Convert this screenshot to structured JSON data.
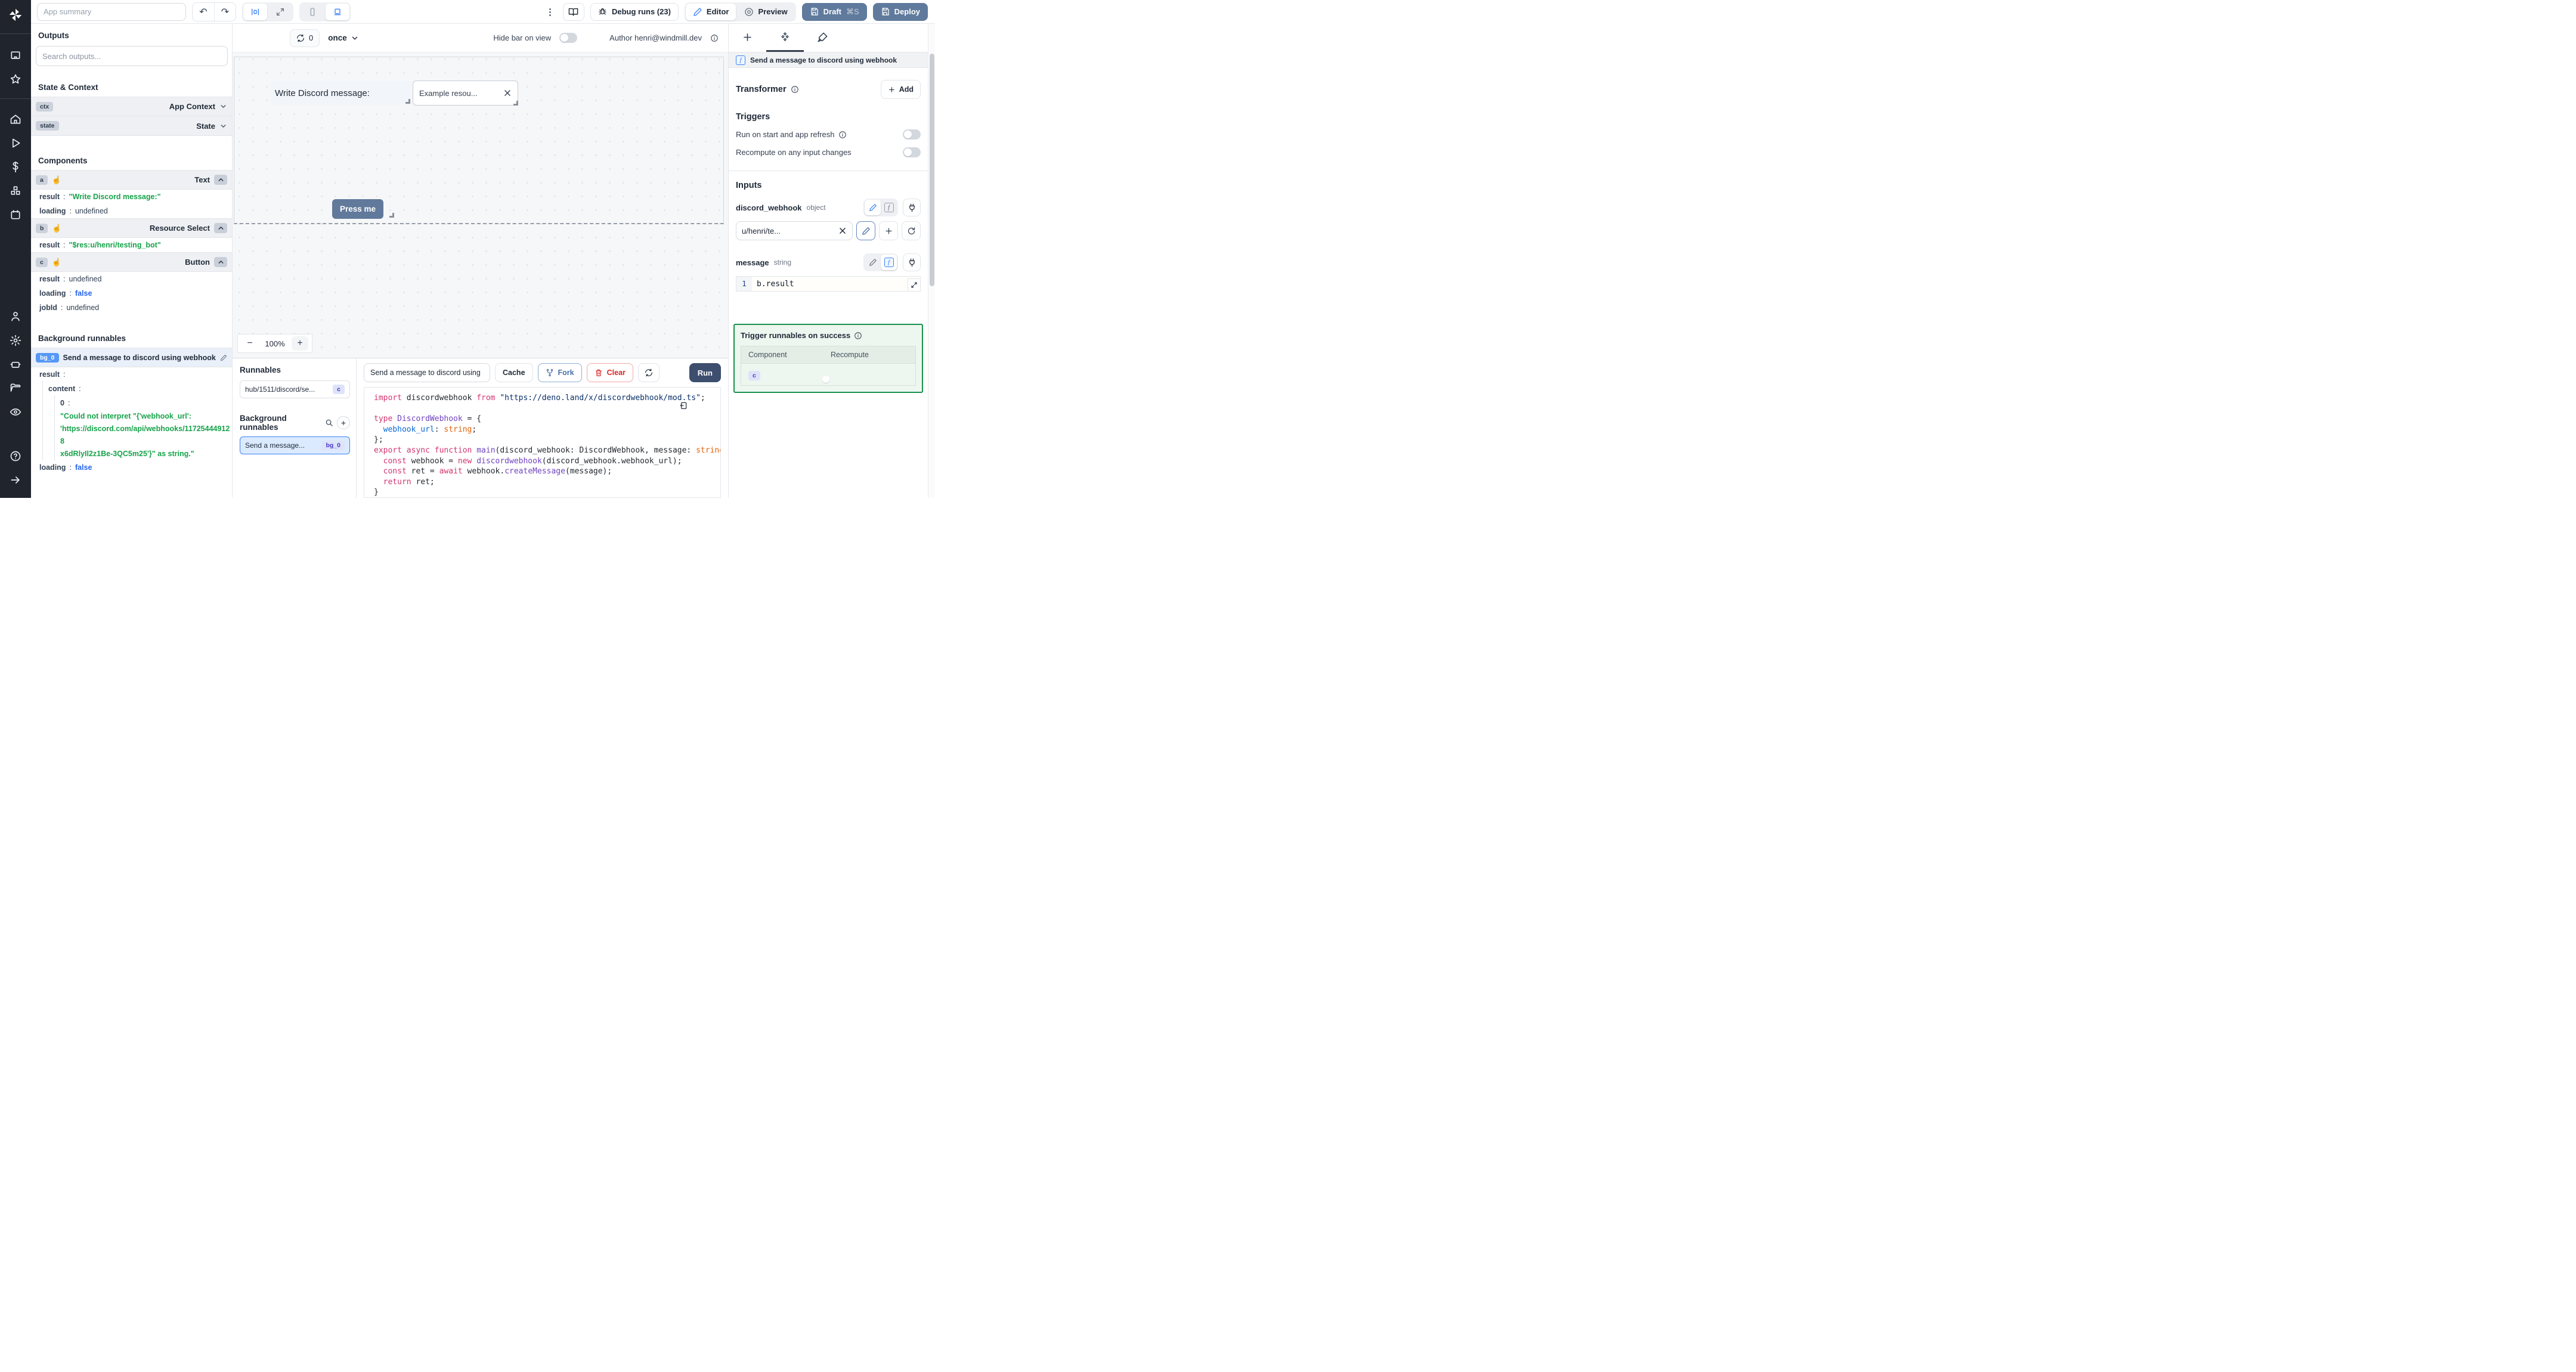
{
  "keys": {
    "colon": ":",
    "result": "result",
    "loading": "loading",
    "jobid": "jobId",
    "content": "content",
    "zero": "0"
  },
  "topbar": {
    "app_summary_placeholder": "App summary",
    "debug_runs_label": "Debug runs (23)",
    "editor_label": "Editor",
    "preview_label": "Preview",
    "draft_label": "Draft",
    "draft_shortcut": "⌘S",
    "deploy_label": "Deploy",
    "kebab": "⋮",
    "undo": "↶",
    "redo": "↷"
  },
  "left_panel": {
    "outputs_title": "Outputs",
    "search_placeholder": "Search outputs...",
    "state_context_title": "State & Context",
    "ctx": {
      "badge": "ctx",
      "type": "App Context"
    },
    "state": {
      "badge": "state",
      "type": "State"
    },
    "components_title": "Components",
    "comp_a": {
      "badge": "a",
      "hand": "☝",
      "type": "Text",
      "result_value": "\"Write Discord message:\"",
      "loading_value": "undefined"
    },
    "comp_b": {
      "badge": "b",
      "hand": "☝",
      "type": "Resource Select",
      "result_value": "\"$res:u/henri/testing_bot\""
    },
    "comp_c": {
      "badge": "c",
      "hand": "☝",
      "type": "Button",
      "result_value": "undefined",
      "loading_value": "false",
      "jobid_value": "undefined"
    },
    "bg_title": "Background runnables",
    "bg0": {
      "badge": "bg_0",
      "title": "Send a message to discord using webhook",
      "error_lines": [
        "\"Could not interpret \"{'webhook_url':",
        "'https://discord.com/api/webhooks/117254449128",
        "x6dRlyIl2z1Be-3QC5m25'}\" as string.\""
      ],
      "loading_value": "false"
    }
  },
  "center": {
    "refresh_count": "0",
    "schedule": "once",
    "hide_bar_label": "Hide bar on view",
    "author_label": "Author henri@windmill.dev",
    "canvas": {
      "text_component": "Write Discord message:",
      "select_value": "Example resou...",
      "button_label": "Press me",
      "zoom_out": "−",
      "zoom_level": "100%",
      "zoom_in": "+"
    }
  },
  "bottom": {
    "runnables_title": "Runnables",
    "runnable_item": {
      "path": "hub/1511/discord/se...",
      "badge": "c"
    },
    "bg_title": "Background runnables",
    "bg_plus": "+",
    "bg_item": {
      "title": "Send a message...",
      "badge": "bg_0"
    },
    "toolbar": {
      "name_value": "Send a message to discord using",
      "cache": "Cache",
      "fork": "Fork",
      "clear": "Clear",
      "run": "Run"
    },
    "code_lines": [
      [
        [
          "kw",
          "import"
        ],
        [
          "pl",
          " discordwebhook "
        ],
        [
          "kw",
          "from"
        ],
        [
          "pl",
          " "
        ],
        [
          "str",
          "\"https://deno.land/x/discordwebhook/mod.ts\""
        ],
        [
          "pl",
          ";"
        ]
      ],
      [],
      [
        [
          "kw",
          "type"
        ],
        [
          "pl",
          " "
        ],
        [
          "ty",
          "DiscordWebhook"
        ],
        [
          "pl",
          " = {"
        ]
      ],
      [
        [
          "pl",
          "  "
        ],
        [
          "pr",
          "webhook_url"
        ],
        [
          "pl",
          ": "
        ],
        [
          "or",
          "string"
        ],
        [
          "pl",
          ";"
        ]
      ],
      [
        [
          "pl",
          "};"
        ]
      ],
      [
        [
          "kw",
          "export"
        ],
        [
          "pl",
          " "
        ],
        [
          "kw",
          "async"
        ],
        [
          "pl",
          " "
        ],
        [
          "kw",
          "function"
        ],
        [
          "pl",
          " "
        ],
        [
          "fn",
          "main"
        ],
        [
          "pl",
          "(discord_webhook: DiscordWebhook, message: "
        ],
        [
          "or",
          "string"
        ],
        [
          "pl",
          ") {"
        ]
      ],
      [
        [
          "pl",
          "  "
        ],
        [
          "kw",
          "const"
        ],
        [
          "pl",
          " webhook = "
        ],
        [
          "kw",
          "new"
        ],
        [
          "pl",
          " "
        ],
        [
          "fn",
          "discordwebhook"
        ],
        [
          "pl",
          "(discord_webhook.webhook_url);"
        ]
      ],
      [
        [
          "pl",
          "  "
        ],
        [
          "kw",
          "const"
        ],
        [
          "pl",
          " ret = "
        ],
        [
          "kw",
          "await"
        ],
        [
          "pl",
          " webhook."
        ],
        [
          "fn",
          "createMessage"
        ],
        [
          "pl",
          "(message);"
        ]
      ],
      [
        [
          "pl",
          "  "
        ],
        [
          "kw",
          "return"
        ],
        [
          "pl",
          " ret;"
        ]
      ],
      [
        [
          "pl",
          "}"
        ]
      ]
    ]
  },
  "right_panel": {
    "header_title": "Send a message to discord using webhook",
    "fn_glyph": "f",
    "transformer_title": "Transformer",
    "add_label": "Add",
    "triggers_title": "Triggers",
    "trigger_start": "Run on start and app refresh",
    "trigger_recompute": "Recompute on any input changes",
    "inputs_title": "Inputs",
    "input1": {
      "name": "discord_webhook",
      "type": "object",
      "value": "u/henri/te..."
    },
    "input2": {
      "name": "message",
      "type": "string",
      "line_no": "1",
      "code": "b.result"
    },
    "success_box": {
      "title": "Trigger runnables on success",
      "col_component": "Component",
      "col_recompute": "Recompute",
      "row_badge": "c"
    }
  }
}
